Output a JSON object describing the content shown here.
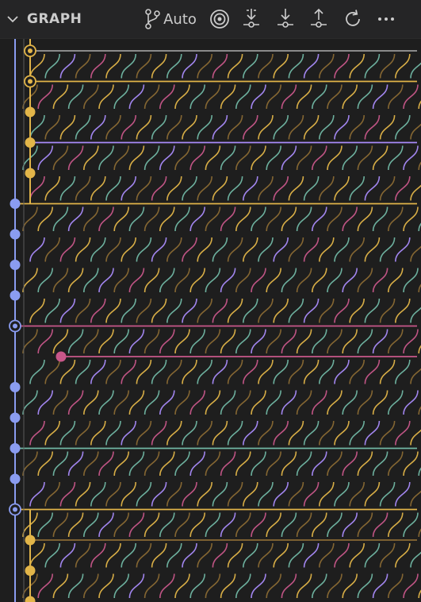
{
  "header": {
    "title": "GRAPH",
    "auto_label": "Auto",
    "icons": [
      "chevron-down-icon",
      "branch-icon",
      "target-icon",
      "fetch-icon",
      "pull-icon",
      "push-icon",
      "refresh-icon",
      "more-icon"
    ]
  },
  "colors": {
    "background": "#1e1e1e",
    "header_bg": "#252526",
    "header_fg": "#cccccc",
    "lane_blue": "#8a9cf0",
    "lane_gold": "#e2b549",
    "lane_purple": "#a98bfa",
    "lane_pink": "#c8578a",
    "lane_teal": "#71b7a4",
    "lane_brown": "#8a6a34"
  },
  "graph": {
    "commits": [
      {
        "lane": "gold",
        "kind": "ref"
      },
      {
        "lane": "gold",
        "kind": "ref"
      },
      {
        "lane": "gold",
        "kind": "dot"
      },
      {
        "lane": "gold",
        "kind": "dot"
      },
      {
        "lane": "gold",
        "kind": "dot"
      },
      {
        "lane": "blue",
        "kind": "dot"
      },
      {
        "lane": "blue",
        "kind": "dot"
      },
      {
        "lane": "blue",
        "kind": "dot"
      },
      {
        "lane": "blue",
        "kind": "dot"
      },
      {
        "lane": "blue",
        "kind": "ref"
      },
      {
        "lane": "pink",
        "kind": "dot"
      },
      {
        "lane": "blue",
        "kind": "dot"
      },
      {
        "lane": "blue",
        "kind": "dot"
      },
      {
        "lane": "blue",
        "kind": "dot"
      },
      {
        "lane": "blue",
        "kind": "dot"
      },
      {
        "lane": "blue",
        "kind": "ref"
      },
      {
        "lane": "gold",
        "kind": "dot"
      },
      {
        "lane": "gold",
        "kind": "dot"
      },
      {
        "lane": "gold",
        "kind": "dot"
      }
    ]
  }
}
